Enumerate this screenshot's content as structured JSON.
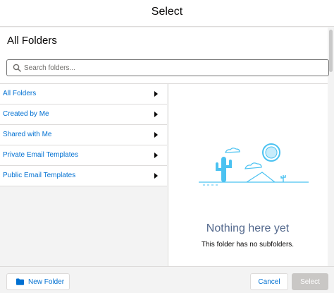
{
  "modal": {
    "title": "Select"
  },
  "panel": {
    "heading": "All Folders"
  },
  "search": {
    "placeholder": "Search folders..."
  },
  "folders": [
    {
      "label": "All Folders"
    },
    {
      "label": "Created by Me"
    },
    {
      "label": "Shared with Me"
    },
    {
      "label": "Private Email Templates"
    },
    {
      "label": "Public Email Templates"
    }
  ],
  "empty_state": {
    "title": "Nothing here yet",
    "subtitle": "This folder has no subfolders."
  },
  "footer": {
    "new_folder_label": "New Folder",
    "cancel_label": "Cancel",
    "select_label": "Select"
  },
  "icons": {
    "search": "search-icon",
    "chevron": "chevron-right-icon",
    "folder": "folder-icon",
    "illustration": "desert-illustration"
  },
  "colors": {
    "link": "#0070d2",
    "empty_title": "#54698d",
    "disabled_button": "#c9c7c5",
    "illustration": "#4bc2f1"
  }
}
